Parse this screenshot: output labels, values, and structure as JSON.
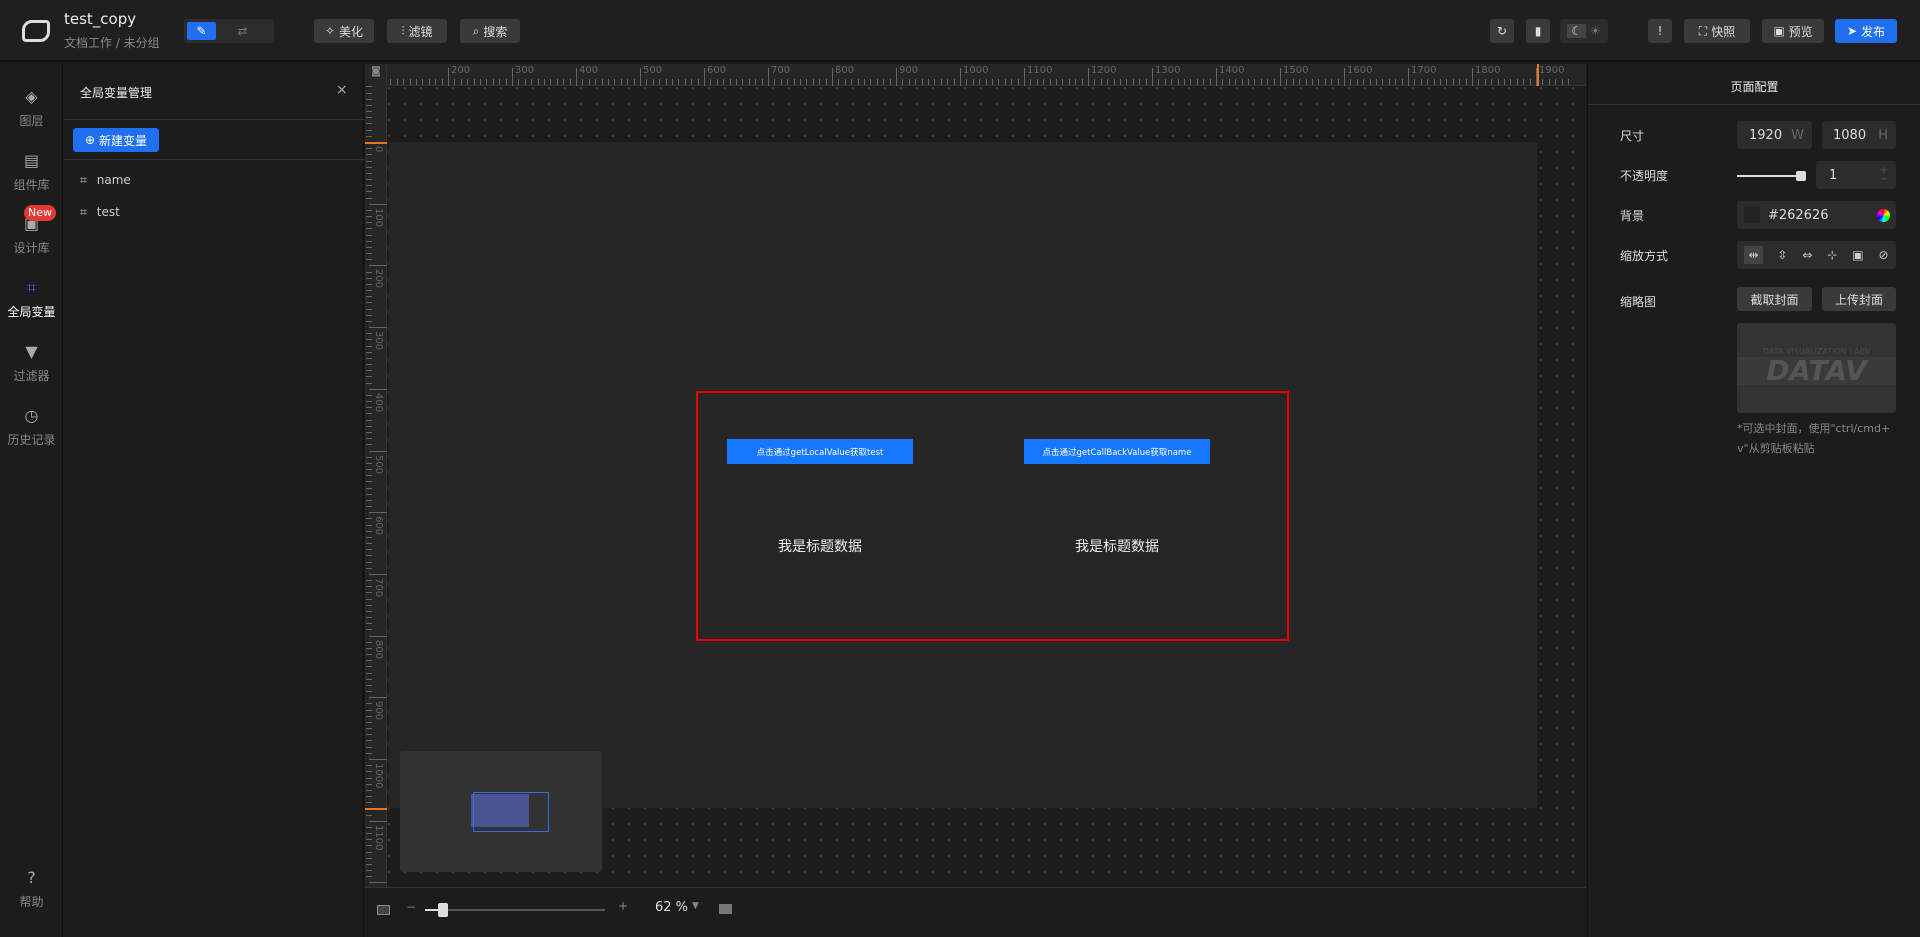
{
  "header": {
    "title": "test_copy",
    "breadcrumb": "文档工作 / 未分组",
    "beautify": "美化",
    "filter": "滤镜",
    "search": "搜索",
    "snapshot": "快照",
    "preview": "预览",
    "publish": "发布"
  },
  "sidebar": {
    "items": [
      {
        "label": "图层",
        "icon": "layers-icon"
      },
      {
        "label": "组件库",
        "icon": "component-icon"
      },
      {
        "label": "设计库",
        "icon": "design-icon",
        "badge": "New"
      },
      {
        "label": "全局变量",
        "icon": "variable-icon",
        "active": true
      },
      {
        "label": "过滤器",
        "icon": "filter-icon"
      },
      {
        "label": "历史记录",
        "icon": "history-icon"
      }
    ],
    "help": "帮助"
  },
  "panel": {
    "title": "全局变量管理",
    "new_button": "新建变量",
    "variables": [
      "name",
      "test"
    ]
  },
  "canvas": {
    "buttons": [
      "点击通过getLocalValue获取test",
      "点击通过getCallBackValue获取name"
    ],
    "titles": [
      "我是标题数据",
      "我是标题数据"
    ],
    "zoom": "62 %",
    "zoom_fraction": 0.1
  },
  "right": {
    "title": "页面配置",
    "size_label": "尺寸",
    "width": "1920",
    "w": "W",
    "height": "1080",
    "h": "H",
    "opacity_label": "不透明度",
    "opacity": "1",
    "bg_label": "背景",
    "bg": "#262626",
    "scale_label": "缩放方式",
    "thumb_label": "缩略图",
    "capture": "截取封面",
    "upload": "上传封面",
    "thumb_text1": "DATA VISUALIZATION LABV",
    "thumb_text2": "DATAV",
    "hint": "*可选中封面，使用\"ctrl/cmd+v\"从剪贴板粘贴"
  },
  "colors": {
    "accent": "#1677ff",
    "selection": "#e00000",
    "ruler_marker": "#e8742a"
  }
}
